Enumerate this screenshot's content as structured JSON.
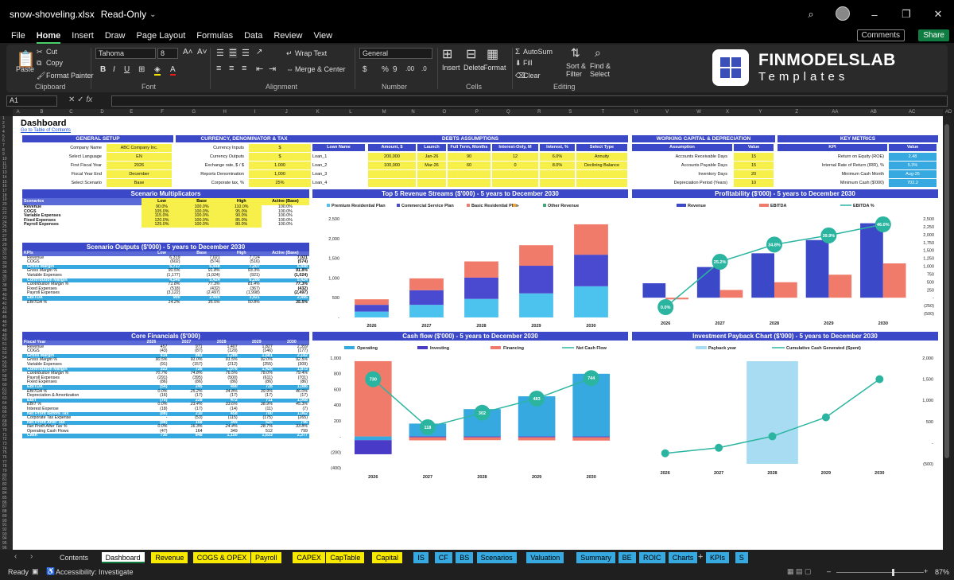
{
  "window": {
    "file_name": "snow-shoveling.xlsx",
    "mode": "Read-Only"
  },
  "menu": [
    "File",
    "Home",
    "Insert",
    "Draw",
    "Page Layout",
    "Formulas",
    "Data",
    "Review",
    "View"
  ],
  "comments_label": "Comments",
  "share_label": "Share",
  "ribbon": {
    "paste": "Paste",
    "cut": "Cut",
    "copy": "Copy",
    "format_painter": "Format Painter",
    "clipboard": "Clipboard",
    "font_name": "Tahoma",
    "font_size": "8",
    "font": "Font",
    "wrap_text": "Wrap Text",
    "merge_center": "Merge & Center",
    "alignment": "Alignment",
    "number_format": "General",
    "number": "Number",
    "insert": "Insert",
    "delete": "Delete",
    "format": "Format",
    "cells": "Cells",
    "autosum": "AutoSum",
    "fill": "Fill",
    "clear": "Clear",
    "sort_filter": "Sort & Filter",
    "find_select": "Find & Select",
    "editing": "Editing"
  },
  "brand": {
    "line1": "FINMODELSLAB",
    "line2": "Templates"
  },
  "name_box": "A1",
  "columns": [
    "A",
    "B",
    "C",
    "D",
    "E",
    "F",
    "G",
    "H",
    "I",
    "J",
    "K",
    "L",
    "M",
    "N",
    "O",
    "P",
    "Q",
    "R",
    "S",
    "T",
    "U",
    "V",
    "W",
    "X",
    "Y",
    "Z",
    "AA",
    "AB",
    "AC",
    "AD"
  ],
  "dashboard": {
    "title": "Dashboard",
    "link": "Go to Table of Contents",
    "general": {
      "title": "GENERAL SETUP",
      "rows": [
        [
          "Company Name",
          "ABC Company Inc."
        ],
        [
          "Select Language",
          "EN"
        ],
        [
          "First Fiscal Year",
          "2026"
        ],
        [
          "Fiscal Year End",
          "December"
        ],
        [
          "Select Scenario",
          "Base"
        ]
      ]
    },
    "currency": {
      "title": "CURRENCY, DENOMINATOR & TAX",
      "rows": [
        [
          "Currency Inputs",
          "$"
        ],
        [
          "Currency Outputs",
          "$"
        ],
        [
          "Exchange rate, $ / $",
          "1.000"
        ],
        [
          "Reports Denomination",
          "1,000"
        ],
        [
          "Corporate tax, %",
          "25%"
        ]
      ]
    },
    "debts": {
      "title": "DEBTS ASSUMPTIONS",
      "headers": [
        "Loan Name",
        "Amount, $",
        "Launch",
        "Full Term, Months",
        "Interest-Only, M",
        "Interest, %",
        "Select Type"
      ],
      "rows": [
        [
          "Loan_1",
          "200,000",
          "Jan-26",
          "90",
          "12",
          "6.0%",
          "Annuity"
        ],
        [
          "Loan_2",
          "100,000",
          "Mar-26",
          "60",
          "0",
          "8.0%",
          "Declining Balance"
        ],
        [
          "Loan_3",
          "",
          "",
          "",
          "",
          "",
          ""
        ],
        [
          "Loan_4",
          "",
          "",
          "",
          "",
          "",
          ""
        ]
      ]
    },
    "wc": {
      "title": "WORKING CAPITAL & DEPRECIATION",
      "h1": "Assumption",
      "h2": "Value",
      "rows": [
        [
          "Accounts Receivable Days",
          "15"
        ],
        [
          "Accounts Payable Days",
          "15"
        ],
        [
          "Inventory Days",
          "20"
        ],
        [
          "Depreciation Period (Years)",
          "10"
        ]
      ]
    },
    "km": {
      "title": "KEY METRICS",
      "h1": "KPI",
      "h2": "Value",
      "rows": [
        [
          "Return on Equity (ROE)",
          "2.48"
        ],
        [
          "Internal Rate of Return (IRR), %",
          "5.3%"
        ],
        [
          "Minimum Cash Month",
          "Aug-26"
        ],
        [
          "Minimum Cash ($'000)",
          "702.2"
        ]
      ]
    },
    "scen": {
      "title": "Scenario Multiplicators",
      "headers": [
        "Scenarios",
        "Low",
        "Base",
        "High",
        "Active (Base)"
      ],
      "rows": [
        [
          "Revenue",
          "90.0%",
          "100.0%",
          "110.0%",
          "100.0%"
        ],
        [
          "COGS",
          "105.0%",
          "100.0%",
          "95.0%",
          "100.0%"
        ],
        [
          "Variable Expenses",
          "115.0%",
          "100.0%",
          "90.0%",
          "100.0%"
        ],
        [
          "Fixed Expenses",
          "120.0%",
          "100.0%",
          "85.0%",
          "100.0%"
        ],
        [
          "Payroll Expenses",
          "125.0%",
          "100.0%",
          "80.0%",
          "100.0%"
        ]
      ]
    },
    "so": {
      "title": "Scenario Outputs ($'000) - 5 years to December 2030",
      "headers": [
        "KPIs",
        "Low",
        "Base",
        "High",
        "Active (Base)"
      ],
      "rows": [
        [
          "Revenue",
          "6,319",
          "7,021",
          "7,724",
          "7,021",
          ""
        ],
        [
          "COGS",
          "(602)",
          "(574)",
          "(516)",
          "(574)",
          ""
        ],
        [
          "Gross Margin",
          "5,717",
          "6,448",
          "7,207",
          "6,448",
          "hl"
        ],
        [
          "Gross Margin %",
          "90.5%",
          "91.8%",
          "93.3%",
          "91.8%",
          "it"
        ],
        [
          "Variable Expenses",
          "(1,177)",
          "(1,024)",
          "(921)",
          "(1,024)",
          ""
        ],
        [
          "Contribution Margin",
          "4,540",
          "5,424",
          "6,286",
          "5,424",
          "hl"
        ],
        [
          "Contribution Margin %",
          "71.8%",
          "77.3%",
          "81.4%",
          "77.3%",
          "it"
        ],
        [
          "Fixed Expenses",
          "(518)",
          "(432)",
          "(367)",
          "(432)",
          ""
        ],
        [
          "Payroll Expenses",
          "(3,122)",
          "(2,497)",
          "(1,998)",
          "(2,497)",
          ""
        ],
        [
          "EBITDA",
          "900",
          "2,495",
          "3,921",
          "2,495",
          "hl"
        ],
        [
          "EBITDA %",
          "14.2%",
          "35.5%",
          "50.8%",
          "35.5%",
          "it"
        ]
      ]
    },
    "cf": {
      "title": "Core Financials ($'000)",
      "headers": [
        "Fiscal Year",
        "2026",
        "2027",
        "2028",
        "2029",
        "2030"
      ],
      "rows": [
        [
          "Revenue",
          "457",
          "971",
          "1,407",
          "1,827",
          "2,359",
          ""
        ],
        [
          "COGS",
          "(43)",
          "(87)",
          "(120)",
          "(146)",
          "(177)",
          ""
        ],
        [
          "Gross Margin",
          "414",
          "883",
          "1,288",
          "1,681",
          "2,182",
          "hl"
        ],
        [
          "Gross Margin %",
          "90.5%",
          "91.0%",
          "91.5%",
          "92.0%",
          "92.5%",
          "it"
        ],
        [
          "Variable Expenses",
          "(91)",
          "(157)",
          "(212)",
          "(255)",
          "(309)",
          ""
        ],
        [
          "Contribution Margin",
          "323",
          "726",
          "1,076",
          "1,426",
          "1,873",
          "hl"
        ],
        [
          "Contribution Margin %",
          "70.7%",
          "74.8%",
          "76.5%",
          "78.0%",
          "79.4%",
          "it"
        ],
        [
          "Payroll Expenses",
          "(291)",
          "(395)",
          "(500)",
          "(611)",
          "(701)",
          ""
        ],
        [
          "Fixed Expenses",
          "(86)",
          "(86)",
          "(86)",
          "(86)",
          "(86)",
          ""
        ],
        [
          "EBITDA",
          "(54)",
          "245",
          "490",
          "728",
          "1,086",
          "hl"
        ],
        [
          "EBITDA %",
          "0.0%",
          "25.2%",
          "34.8%",
          "39.9%",
          "46.0%",
          "it"
        ],
        [
          "Depreciation & Amortization",
          "(16)",
          "(17)",
          "(17)",
          "(17)",
          "(17)",
          ""
        ],
        [
          "EBIT",
          "(70)",
          "228",
          "472",
          "711",
          "1,068",
          "hl"
        ],
        [
          "EBIT %",
          "0.0%",
          "23.4%",
          "33.6%",
          "38.9%",
          "45.3%",
          "it"
        ],
        [
          "Interest Expense",
          "(18)",
          "(17)",
          "(14)",
          "(11)",
          "(7)",
          ""
        ],
        [
          "Net Profit Before Tax",
          "(88)",
          "210",
          "458",
          "700",
          "1,062",
          "hl"
        ],
        [
          "Corporate Tax Expense",
          "-",
          "(53)",
          "(115)",
          "(175)",
          "(265)",
          ""
        ],
        [
          "Net Profit After Tax",
          "(88)",
          "158",
          "344",
          "525",
          "796",
          "hl"
        ],
        [
          "Net Profit After Tax %",
          "0.0%",
          "16.3%",
          "24.4%",
          "28.7%",
          "33.8%",
          "it"
        ],
        [
          "Operating Cash Flows",
          "(47)",
          "164",
          "349",
          "512",
          "799",
          ""
        ],
        [
          "Cash",
          "730",
          "848",
          "1,150",
          "1,633",
          "2,377",
          "hl"
        ]
      ]
    }
  },
  "chart_data": [
    {
      "title": "Top 5 Revenue Streams ($'000) - 5 years to December 2030",
      "type": "bar",
      "stacked": true,
      "categories": [
        "2026",
        "2027",
        "2028",
        "2029",
        "2030"
      ],
      "ylim": [
        0,
        2500
      ],
      "legend": [
        "Premium Residential Plan",
        "Commercial Service Plan",
        "Basic Residential Plan",
        "-",
        "Other Revenue"
      ],
      "colors": [
        "#4cc3ef",
        "#4a4ad0",
        "#f07b6b",
        "#f2a830",
        "#3fa877"
      ],
      "series": [
        {
          "name": "Premium Residential Plan",
          "values": [
            150,
            320,
            470,
            610,
            790
          ]
        },
        {
          "name": "Commercial Service Plan",
          "values": [
            170,
            370,
            540,
            700,
            800
          ]
        },
        {
          "name": "Basic Residential Plan",
          "values": [
            140,
            300,
            410,
            520,
            770
          ]
        }
      ]
    },
    {
      "title": "Profitability ($'000) - 5 years to December 2030",
      "type": "bar",
      "categories": [
        "2026",
        "2027",
        "2028",
        "2029",
        "2030"
      ],
      "ylim": [
        -500,
        2500
      ],
      "y2": [
        "0.0%",
        "25.2%",
        "34.8%",
        "39.9%",
        "46.0%"
      ],
      "legend": [
        "Revenue",
        "EBITDA",
        "EBITDA %"
      ],
      "series": [
        {
          "name": "Revenue",
          "values": [
            457,
            971,
            1407,
            1827,
            2359
          ]
        },
        {
          "name": "EBITDA",
          "values": [
            -54,
            245,
            490,
            728,
            1086
          ]
        },
        {
          "name": "EBITDA %",
          "values": [
            0.0,
            25.2,
            34.8,
            39.9,
            46.0
          ]
        }
      ]
    },
    {
      "title": "Cash flow ($'000) - 5 years to December 2030",
      "type": "bar",
      "categories": [
        "2026",
        "2027",
        "2028",
        "2029",
        "2030"
      ],
      "ylim": [
        -400,
        1000
      ],
      "legend": [
        "Operating",
        "Investing",
        "Financing",
        "Net Cash Flow"
      ],
      "series": [
        {
          "name": "Operating",
          "values": [
            -47,
            164,
            349,
            512,
            799
          ]
        },
        {
          "name": "Investing",
          "values": [
            -180,
            -10,
            -10,
            -10,
            -10
          ]
        },
        {
          "name": "Financing",
          "values": [
            960,
            -40,
            -37,
            -40,
            -43
          ]
        },
        {
          "name": "Net Cash Flow",
          "values": [
            730,
            118,
            302,
            483,
            744
          ]
        }
      ]
    },
    {
      "title": "Investment Payback Chart ($'000) - 5 years to December 2030",
      "type": "line",
      "categories": [
        "2026",
        "2027",
        "2028",
        "2029",
        "2030"
      ],
      "ylim": [
        -500,
        2000
      ],
      "legend": [
        "Payback year",
        "Cumulative Cash Generated (Spent)"
      ],
      "payback_year": "2028",
      "series": [
        {
          "name": "Cumulative Cash Generated (Spent)",
          "values": [
            -250,
            -120,
            150,
            600,
            1500
          ]
        }
      ]
    }
  ],
  "sheet_tabs": [
    "Contents",
    "Dashboard",
    "Revenue",
    "COGS & OPEX",
    "Payroll",
    "CAPEX",
    "CapTable",
    "Capital",
    "IS",
    "CF",
    "BS",
    "Scenarios",
    "Valuation",
    "Summary",
    "BE",
    "ROIC",
    "Charts",
    "KPIs",
    "S"
  ],
  "status": {
    "ready": "Ready",
    "accessibility": "Accessibility: Investigate",
    "zoom": "87%"
  }
}
